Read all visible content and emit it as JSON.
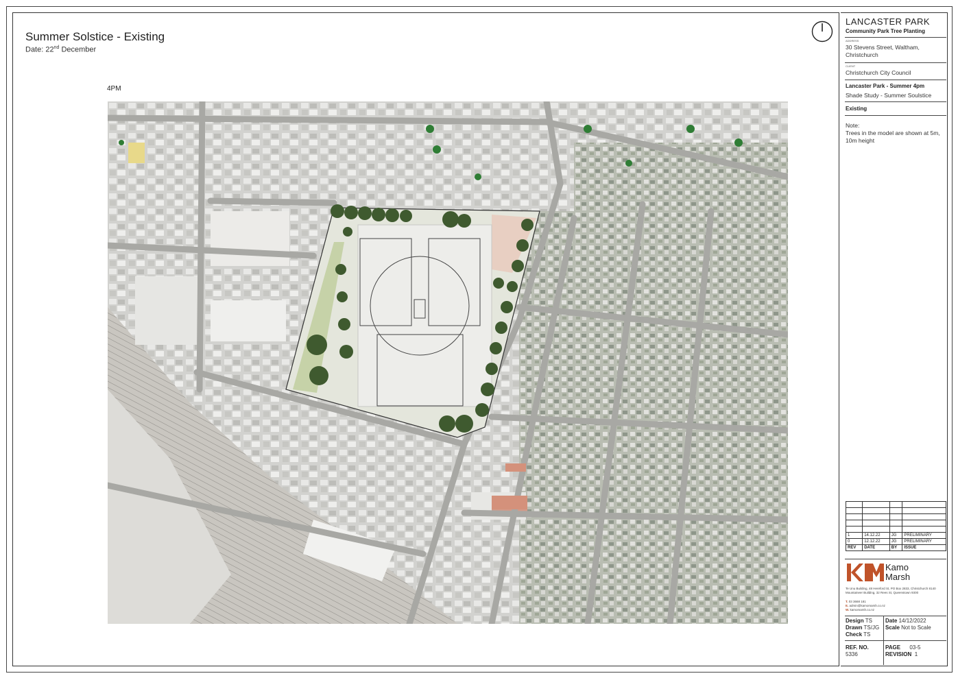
{
  "sheet": {
    "title": "Summer Solstice - Existing",
    "date_prefix": "Date: 22",
    "date_sup": "nd",
    "date_suffix": " December",
    "time_label": "4PM"
  },
  "title_block": {
    "project": "LANCASTER PARK",
    "project_sub": "Community Park Tree Planting",
    "address_caption": "ADDRESS",
    "address": "30 Stevens Street, Waltham, Christchurch",
    "client_caption": "CLIENT",
    "client": "Christchurch City Council",
    "drawing_title": "Lancaster Park - Summer 4pm",
    "drawing_sub": "Shade Study - Summer Soulstice",
    "status": "Existing",
    "note_title": "Note:",
    "note": "Trees in the model are shown at 5m, 10m height"
  },
  "revisions": {
    "headers": [
      "REV",
      "DATE",
      "BY",
      "ISSUE"
    ],
    "rows": [
      [
        "1",
        "14.12.22",
        "JG",
        "PRELIMINARY"
      ],
      [
        "0",
        "12.12.22",
        "JG",
        "PRELIMINARY"
      ]
    ]
  },
  "company": {
    "name_line1": "Kamo",
    "name_line2": "Marsh",
    "address_1": "Te Unu Building, 48 Hereford St, PO Box 2833, Christchurch 8140",
    "address_2": "Mountaineer Building, 32 Rees St, Queenstown 9300",
    "phone_label": "T.",
    "phone": "03 3668 181",
    "email_label": "E.",
    "email": "admin@kamomarsh.co.nz",
    "web_label": "W.",
    "web": "kamomarsh.co.nz",
    "logo_color": "#c0532a"
  },
  "meta": {
    "design_label": "Design",
    "design": "TS",
    "drawn_label": "Drawn",
    "drawn": "TS/JG",
    "check_label": "Check",
    "check": "TS",
    "date_label": "Date",
    "date": "14/12/2022",
    "scale_label": "Scale",
    "scale": "Not to Scale",
    "ref_label": "REF. NO.",
    "ref": "5336",
    "page_label": "PAGE",
    "page": "03-5",
    "revision_label": "REVISION",
    "revision": "1"
  }
}
